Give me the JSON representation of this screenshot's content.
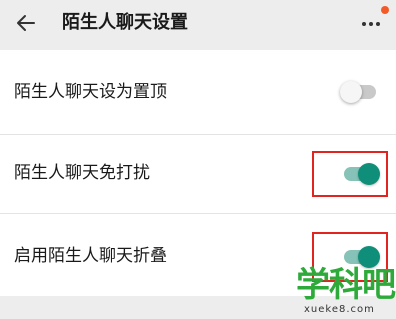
{
  "header": {
    "title": "陌生人聊天设置",
    "back_icon": "arrow-left-icon",
    "more_icon": "more-vertical-icon",
    "notification_dot_color": "#f25a2a"
  },
  "settings": [
    {
      "label": "陌生人聊天设为置顶",
      "enabled": false
    },
    {
      "label": "陌生人聊天免打扰",
      "enabled": true
    },
    {
      "label": "启用陌生人聊天折叠",
      "enabled": true
    }
  ],
  "colors": {
    "toggle_on": "#0f8f7a",
    "toggle_on_track": "#86c2b7",
    "toggle_off_track": "#c9c9c9",
    "highlight": "#e0241f"
  },
  "watermark": {
    "main": "学科吧",
    "sub": "xueke8.com"
  }
}
